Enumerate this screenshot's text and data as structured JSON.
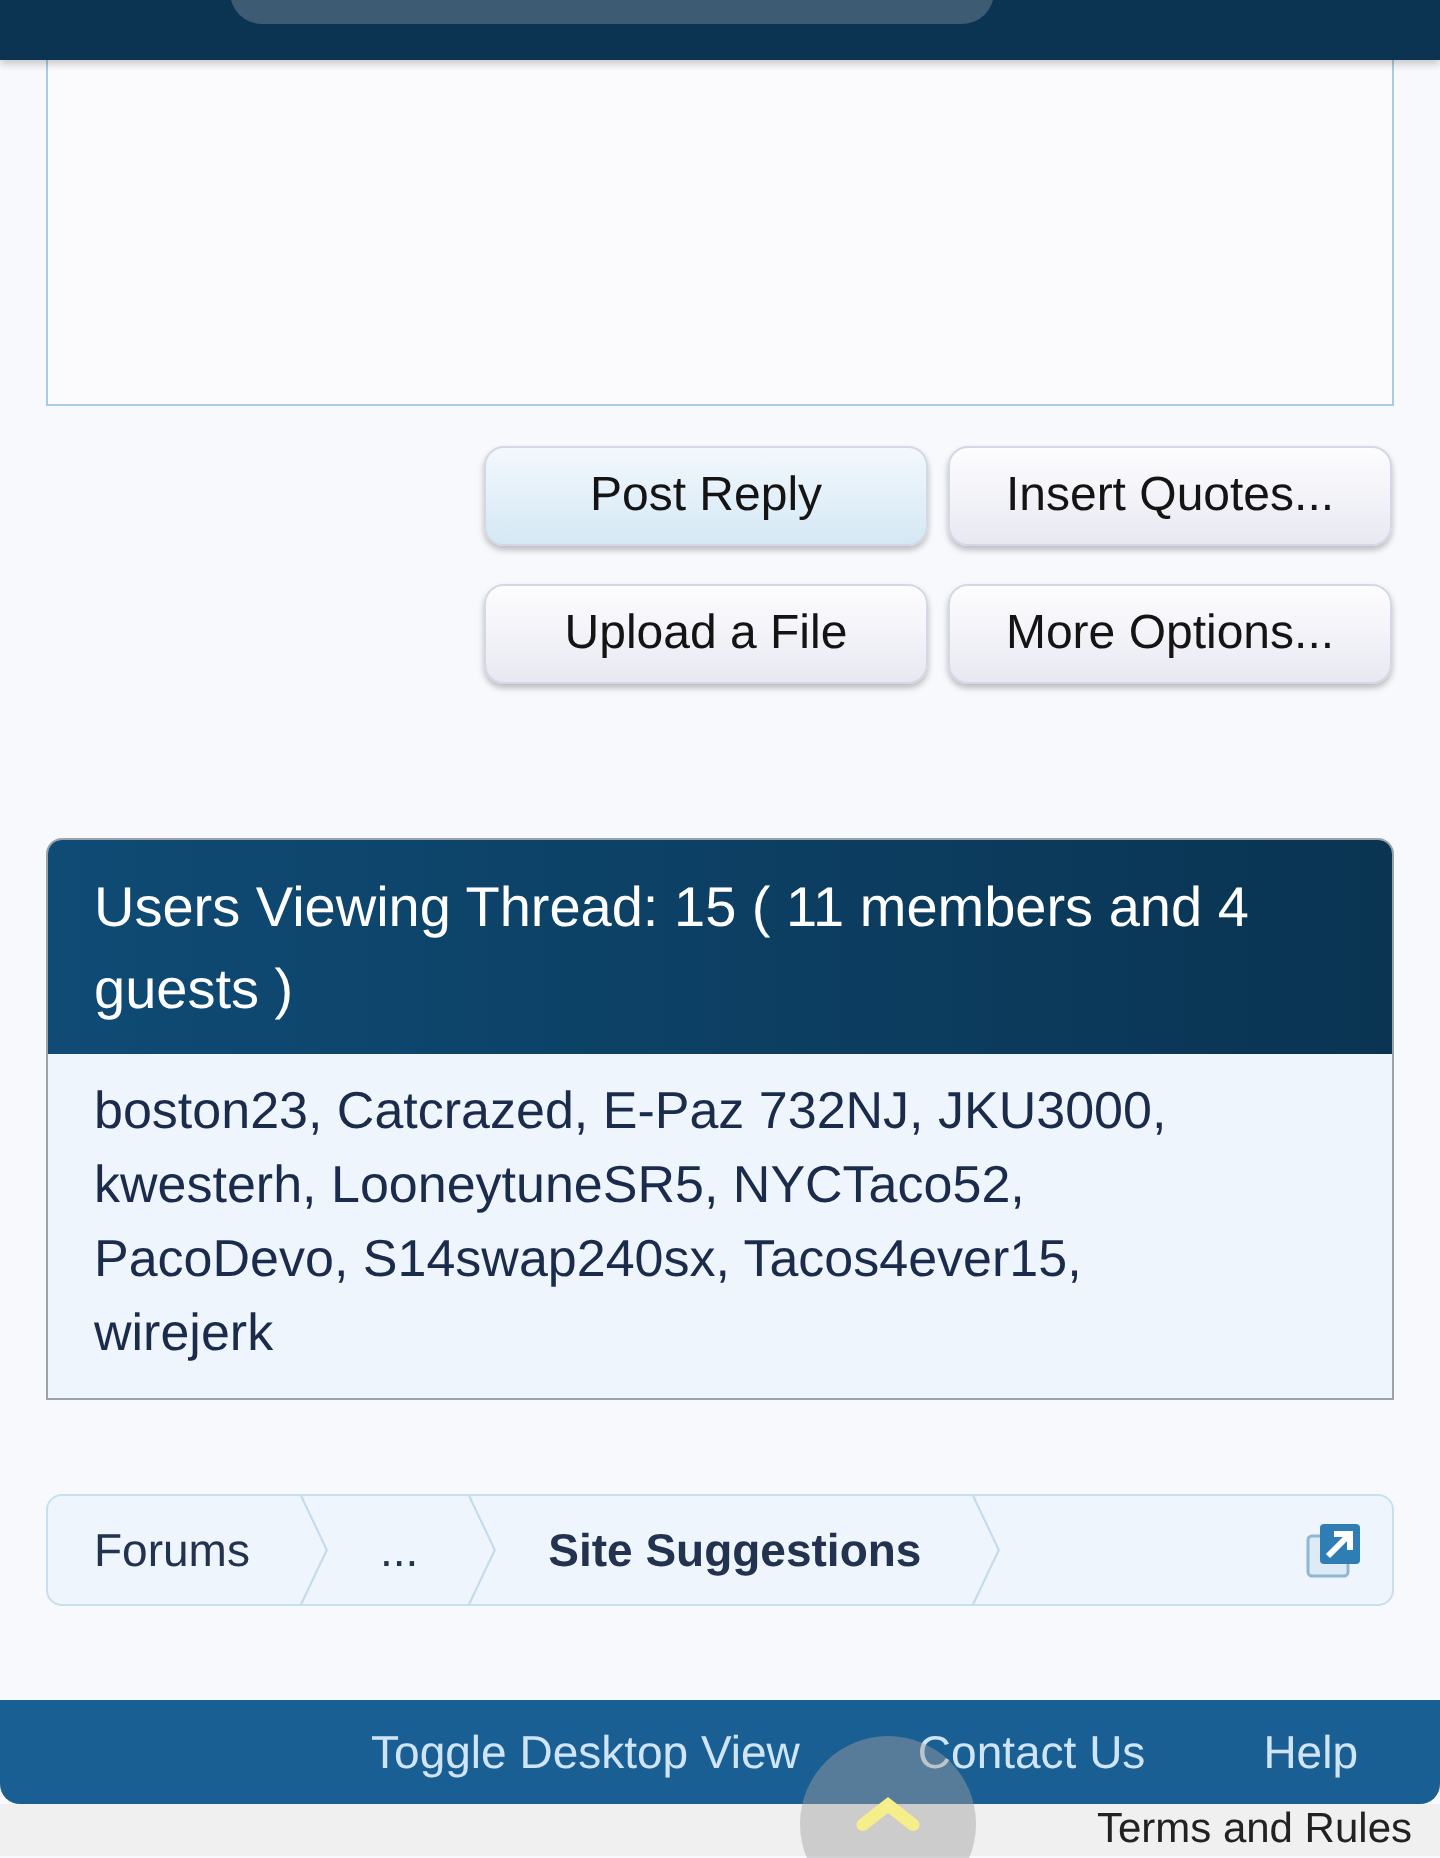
{
  "buttons": [
    {
      "label": "Post Reply",
      "kind": "primary"
    },
    {
      "label": "Insert Quotes...",
      "kind": "secondary"
    },
    {
      "label": "Upload a File",
      "kind": "secondary"
    },
    {
      "label": "More Options...",
      "kind": "secondary"
    }
  ],
  "users_panel": {
    "title": "Users Viewing Thread: 15 ( 11 members and 4 guests )",
    "members": "boston23, Catcrazed, E-Paz 732NJ, JKU3000, kwesterh, LooneytuneSR5, NYCTaco52, PacoDevo, S14swap240sx, Tacos4ever15, wirejerk"
  },
  "breadcrumb": [
    {
      "label": "Forums",
      "current": false
    },
    {
      "label": "...",
      "current": false
    },
    {
      "label": "Site Suggestions",
      "current": true
    }
  ],
  "footer_links": [
    "Toggle Desktop View",
    "Contact Us",
    "Help"
  ],
  "bottom_text": "Terms and Rules"
}
